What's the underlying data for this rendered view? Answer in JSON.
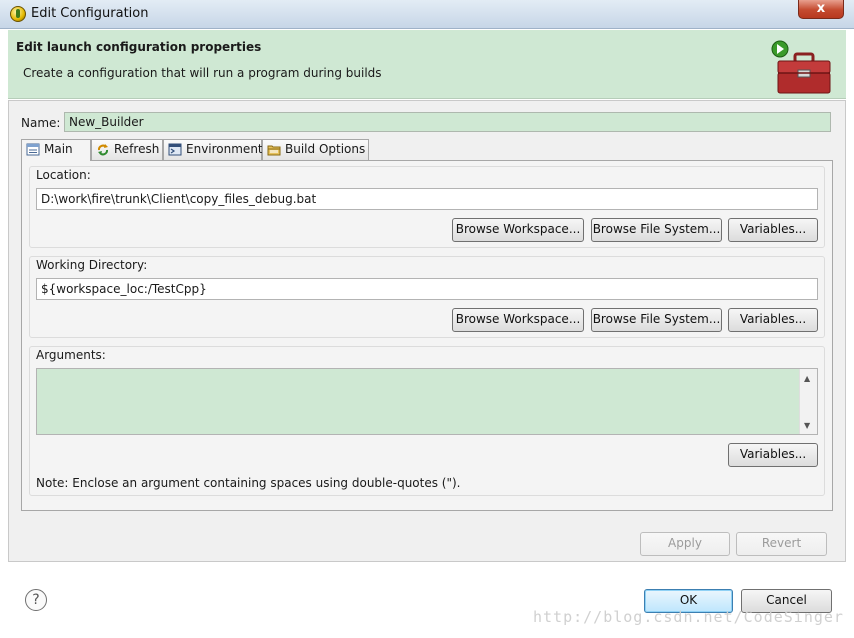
{
  "window": {
    "title": "Edit Configuration",
    "close_label": "x"
  },
  "banner": {
    "title": "Edit launch configuration properties",
    "description": "Create a configuration that will run a program during builds"
  },
  "name": {
    "label": "Name:",
    "value": "New_Builder"
  },
  "tabs": [
    {
      "label": "Main",
      "icon": "main-tab-icon"
    },
    {
      "label": "Refresh",
      "icon": "refresh-icon"
    },
    {
      "label": "Environment",
      "icon": "environment-icon"
    },
    {
      "label": "Build Options",
      "icon": "folder-icon"
    }
  ],
  "location": {
    "label": "Location:",
    "value": "D:\\work\\fire\\trunk\\Client\\copy_files_debug.bat",
    "browse_workspace": "Browse Workspace...",
    "browse_file_system": "Browse File System...",
    "variables": "Variables..."
  },
  "working_directory": {
    "label": "Working Directory:",
    "value": "${workspace_loc:/TestCpp}",
    "browse_workspace": "Browse Workspace...",
    "browse_file_system": "Browse File System...",
    "variables": "Variables..."
  },
  "arguments": {
    "label": "Arguments:",
    "value": "",
    "variables": "Variables...",
    "note": "Note: Enclose an argument containing spaces using double-quotes (\")."
  },
  "actions": {
    "apply": "Apply",
    "revert": "Revert",
    "ok": "OK",
    "cancel": "Cancel"
  },
  "help": {
    "label": "?"
  },
  "watermark": "http://blog.csdn.net/CodeSinger",
  "colors": {
    "banner_bg": "#cfe8d3",
    "field_highlight": "#cfe8d3",
    "close_button": "#c44a2f"
  }
}
